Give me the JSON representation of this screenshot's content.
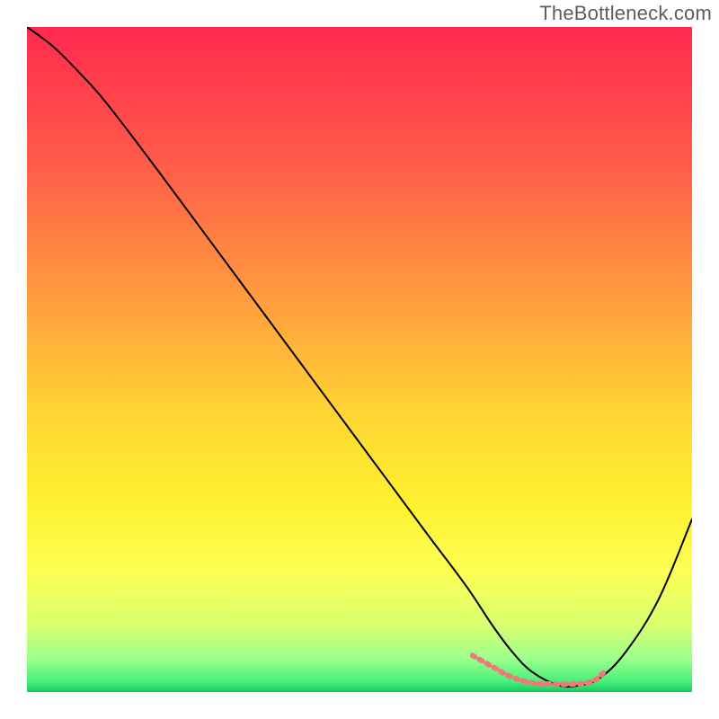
{
  "watermark": "TheBottleneck.com",
  "chart_data": {
    "type": "line",
    "title": "",
    "xlabel": "",
    "ylabel": "",
    "xlim": [
      0,
      100
    ],
    "ylim": [
      0,
      100
    ],
    "grid": false,
    "legend": false,
    "background_gradient": {
      "stops": [
        {
          "pos": 0.0,
          "color": "#ff2a4f"
        },
        {
          "pos": 0.2,
          "color": "#ff5a49"
        },
        {
          "pos": 0.4,
          "color": "#ff9a3f"
        },
        {
          "pos": 0.58,
          "color": "#ffd433"
        },
        {
          "pos": 0.72,
          "color": "#fff230"
        },
        {
          "pos": 0.82,
          "color": "#fdff55"
        },
        {
          "pos": 0.9,
          "color": "#d8ff70"
        },
        {
          "pos": 0.95,
          "color": "#9cff8c"
        },
        {
          "pos": 0.985,
          "color": "#45f07a"
        },
        {
          "pos": 1.0,
          "color": "#16c95c"
        }
      ]
    },
    "series": [
      {
        "name": "bottleneck-curve",
        "color": "#000000",
        "width": 2,
        "x": [
          0,
          4,
          8,
          12,
          20,
          30,
          40,
          50,
          60,
          66,
          70,
          73,
          76,
          80,
          83,
          86,
          90,
          95,
          100
        ],
        "y": [
          100,
          97,
          93,
          88.5,
          78,
          64.5,
          51,
          37.5,
          24,
          16,
          10,
          6,
          3,
          1,
          1,
          2,
          6,
          14,
          26
        ]
      },
      {
        "name": "optimal-zone-marker",
        "color": "#f07878",
        "width": 6,
        "dash": [
          3,
          6
        ],
        "x": [
          67,
          70,
          73,
          76,
          79,
          82,
          85,
          87
        ],
        "y": [
          5.5,
          3.8,
          2.2,
          1.4,
          1.2,
          1.2,
          1.6,
          3.2
        ]
      }
    ]
  }
}
